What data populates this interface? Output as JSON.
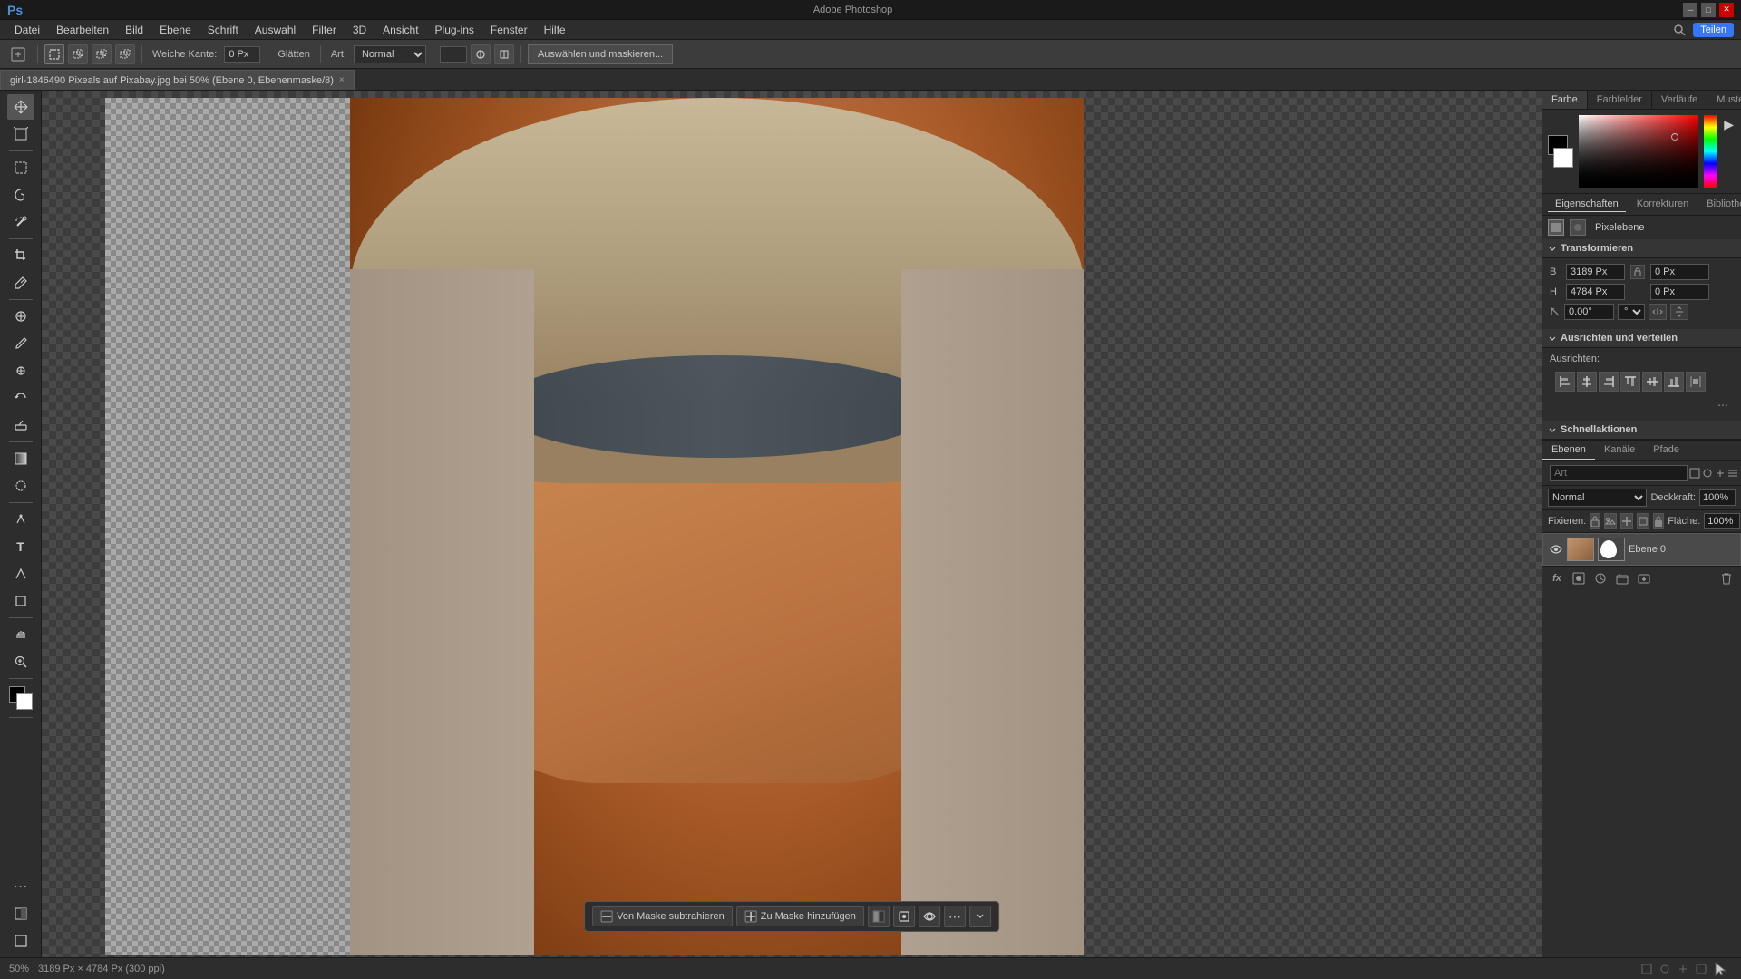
{
  "window": {
    "title": "Adobe Photoshop",
    "minimize": "─",
    "restore": "□",
    "close": "✕"
  },
  "menu": {
    "items": [
      "Datei",
      "Bearbeiten",
      "Bild",
      "Ebene",
      "Schrift",
      "Auswahl",
      "Filter",
      "3D",
      "Ansicht",
      "Plug-ins",
      "Fenster",
      "Hilfe"
    ]
  },
  "toolbar": {
    "edge_label": "Weiche Kante:",
    "edge_value": "0 Px",
    "glitter_label": "Glätten",
    "art_label": "Art:",
    "art_value": "Normal",
    "select_mask_btn": "Auswählen und maskieren..."
  },
  "tab": {
    "filename": "girl-1846490 Pixeals auf Pixabay.jpg bei 50% (Ebene 0, Ebenenmaske/8)",
    "close": "×"
  },
  "canvas": {
    "zoom": "50%",
    "dimensions": "3189 Px × 4784 Px (300 ppi)"
  },
  "floating_toolbar": {
    "subtract_btn": "Von Maske subtrahieren",
    "add_btn": "Zu Maske hinzufügen"
  },
  "right_panel": {
    "color_tabs": [
      "Farbe",
      "Farbfelder",
      "Verläufe",
      "Muster"
    ],
    "active_color_tab": "Farbe"
  },
  "properties": {
    "tabs": [
      "Eigenschaften",
      "Korrekturen",
      "Bibliotheken"
    ],
    "active_tab": "Eigenschaften",
    "layer_type": "Pixelebene",
    "transform_section": "Transformieren",
    "width_label": "B",
    "width_value": "3189 Px",
    "width_x": "0 Px",
    "height_label": "H",
    "height_value": "4784 Px",
    "height_y": "0 Px",
    "angle_value": "0.00°",
    "align_section": "Ausrichten und verteilen",
    "align_label": "Ausrichten:",
    "quick_actions": "Schnellaktionen"
  },
  "layers": {
    "tabs": [
      "Ebenen",
      "Kanäle",
      "Pfade"
    ],
    "active_tab": "Ebenen",
    "filter_label": "Art",
    "mode_label": "Normal",
    "opacity_label": "Deckkraft:",
    "opacity_value": "100%",
    "lock_label": "Fixieren:",
    "fill_label": "Fläche:",
    "fill_value": "100%",
    "layer_name": "Ebene 0"
  },
  "status": {
    "zoom": "50%",
    "dimensions": "3189 Px × 4784 Px (300 ppi)"
  },
  "icons": {
    "move": "✥",
    "artboard": "⬚",
    "marquee": "⬜",
    "lasso": "🔤",
    "magic_wand": "✦",
    "crop": "⊹",
    "eyedropper": "✏",
    "heal": "⊕",
    "brush": "🖌",
    "clone": "◈",
    "eraser": "◻",
    "gradient": "▣",
    "blur": "◎",
    "pen": "✒",
    "text": "T",
    "path": "◇",
    "shape": "⬡",
    "hand": "✋",
    "zoom_tool": "⊕",
    "more": "⋯"
  }
}
